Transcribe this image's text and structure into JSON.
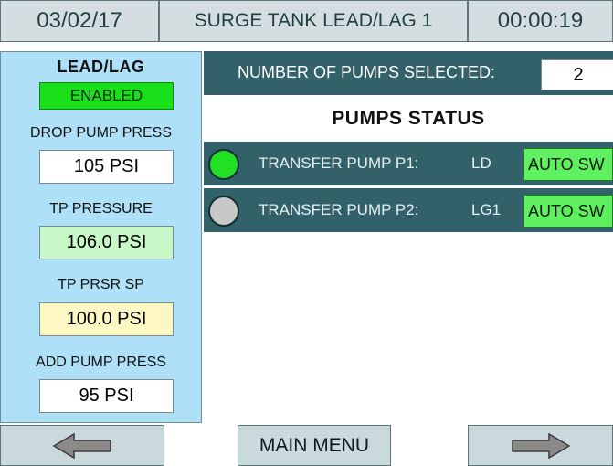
{
  "header": {
    "date": "03/02/17",
    "title": "SURGE TANK LEAD/LAG 1",
    "time": "00:00:19"
  },
  "left_panel": {
    "lead_lag_label": "LEAD/LAG",
    "lead_lag_status": "ENABLED",
    "drop_pump_press_label": "DROP PUMP PRESS",
    "drop_pump_press_value": "105 PSI",
    "tp_pressure_label": "TP PRESSURE",
    "tp_pressure_value": "106.0 PSI",
    "tp_prsr_sp_label": "TP PRSR SP",
    "tp_prsr_sp_value": "100.0 PSI",
    "add_pump_press_label": "ADD PUMP PRESS",
    "add_pump_press_value": "95 PSI"
  },
  "pumps_selected": {
    "label": "NUMBER OF PUMPS SELECTED:",
    "value": "2"
  },
  "pumps_status": {
    "title": "PUMPS STATUS",
    "pumps": [
      {
        "label": "TRANSFER PUMP P1:",
        "mode": "LD",
        "auto": "AUTO SW",
        "indicator_color": "#22e022",
        "running": true
      },
      {
        "label": "TRANSFER PUMP P2:",
        "mode": "LG1",
        "auto": "AUTO SW",
        "indicator_color": "#c8c8c8",
        "running": false
      }
    ]
  },
  "nav": {
    "back_icon": "arrow-left-icon",
    "main_menu_label": "MAIN MENU",
    "forward_icon": "arrow-right-icon"
  },
  "colors": {
    "panel_blue": "#aee0f7",
    "teal": "#33616a",
    "green_status": "#19e01a",
    "pressure_green": "#c8f7c8",
    "setpoint_yellow": "#fdf7c4"
  }
}
